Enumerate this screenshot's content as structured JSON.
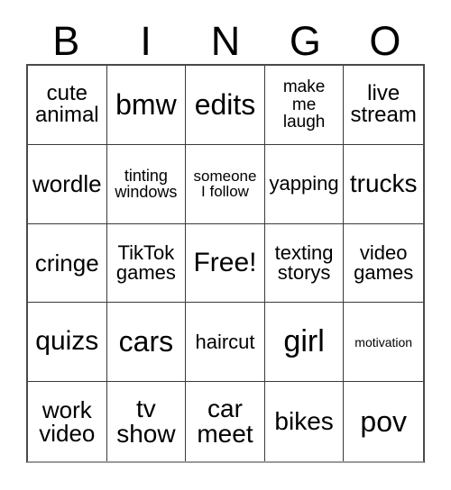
{
  "card": {
    "header_letters": [
      "B",
      "I",
      "N",
      "G",
      "O"
    ],
    "free_space_label": "Free!",
    "free_space_index": 12,
    "background_color": "#ffffff",
    "text_color": "#000000",
    "border_color": "#3a3a3a",
    "rows": 5,
    "columns": 5,
    "cells": [
      {
        "text": "cute\nanimal",
        "size_class": "fs-24"
      },
      {
        "text": "bmw",
        "size_class": "fs-32"
      },
      {
        "text": "edits",
        "size_class": "fs-32"
      },
      {
        "text": "make\nme\nlaugh",
        "size_class": "fs-19"
      },
      {
        "text": "live\nstream",
        "size_class": "fs-24"
      },
      {
        "text": "wordle",
        "size_class": "fs-26"
      },
      {
        "text": "tinting\nwindows",
        "size_class": "fs-18"
      },
      {
        "text": "someone\nI follow",
        "size_class": "fs-17"
      },
      {
        "text": "yapping",
        "size_class": "fs-22"
      },
      {
        "text": "trucks",
        "size_class": "fs-28"
      },
      {
        "text": "cringe",
        "size_class": "fs-26"
      },
      {
        "text": "TikTok\ngames",
        "size_class": "fs-22"
      },
      {
        "text": "Free!",
        "size_class": "fs-30"
      },
      {
        "text": "texting\nstorys",
        "size_class": "fs-22"
      },
      {
        "text": "video\ngames",
        "size_class": "fs-22"
      },
      {
        "text": "quizs",
        "size_class": "fs-30"
      },
      {
        "text": "cars",
        "size_class": "fs-32"
      },
      {
        "text": "haircut",
        "size_class": "fs-22"
      },
      {
        "text": "girl",
        "size_class": "fs-34"
      },
      {
        "text": "motivation",
        "size_class": "fs-14"
      },
      {
        "text": "work\nvideo",
        "size_class": "fs-26"
      },
      {
        "text": "tv\nshow",
        "size_class": "fs-28"
      },
      {
        "text": "car\nmeet",
        "size_class": "fs-28"
      },
      {
        "text": "bikes",
        "size_class": "fs-28"
      },
      {
        "text": "pov",
        "size_class": "fs-32"
      }
    ]
  }
}
